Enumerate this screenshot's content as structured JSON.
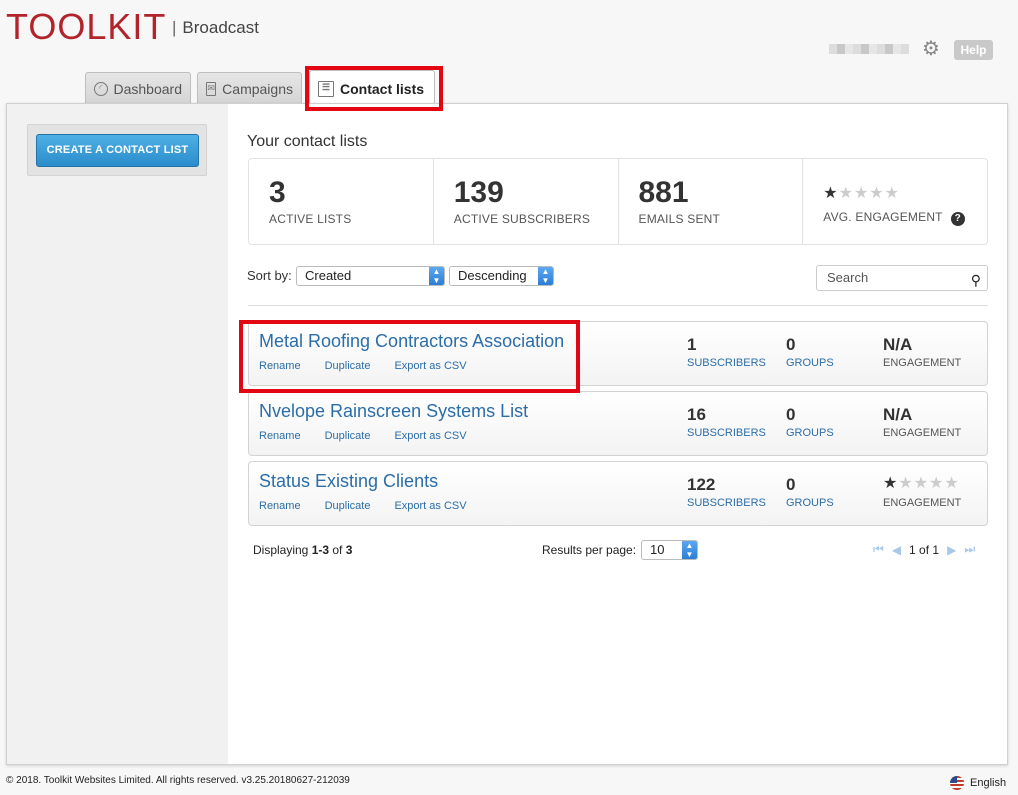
{
  "header": {
    "logo": "TOOLKIT",
    "product": "Broadcast",
    "help_label": "Help"
  },
  "tabs": [
    {
      "label": "Dashboard"
    },
    {
      "label": "Campaigns"
    },
    {
      "label": "Contact lists"
    }
  ],
  "sidebar": {
    "create_label": "CREATE A CONTACT LIST"
  },
  "main": {
    "heading": "Your contact lists",
    "stats": [
      {
        "value": "3",
        "label": "ACTIVE LISTS"
      },
      {
        "value": "139",
        "label": "ACTIVE SUBSCRIBERS"
      },
      {
        "value": "881",
        "label": "EMAILS SENT"
      },
      {
        "label": "AVG. ENGAGEMENT",
        "rating": 0.5,
        "max": 5
      }
    ],
    "sort": {
      "label": "Sort by:",
      "field": "Created",
      "order": "Descending"
    },
    "search_placeholder": "Search",
    "actions": {
      "rename": "Rename",
      "duplicate": "Duplicate",
      "export": "Export as CSV"
    },
    "metric_labels": {
      "subscribers": "SUBSCRIBERS",
      "groups": "GROUPS",
      "engagement": "ENGAGEMENT"
    },
    "lists": [
      {
        "name": "Metal Roofing Contractors Association",
        "subscribers": "1",
        "groups": "0",
        "engagement": "N/A"
      },
      {
        "name": "Nvelope Rainscreen Systems List",
        "subscribers": "16",
        "groups": "0",
        "engagement": "N/A"
      },
      {
        "name": "Status Existing Clients",
        "subscribers": "122",
        "groups": "0",
        "engagement": "",
        "rating": 0.5
      }
    ],
    "footer": {
      "displaying_prefix": "Displaying ",
      "range": "1-3",
      "of": " of ",
      "total": "3",
      "per_page_label": "Results per page:",
      "per_page": "10",
      "page_of": "1 of 1"
    }
  },
  "page_footer": {
    "copyright": "© 2018. Toolkit Websites Limited. All rights reserved. v3.25.20180627-212039",
    "language": "English"
  },
  "colors": {
    "brand": "#b2232b",
    "link": "#2b6da8",
    "highlight": "#e30613",
    "button": "#2a8ccb"
  }
}
